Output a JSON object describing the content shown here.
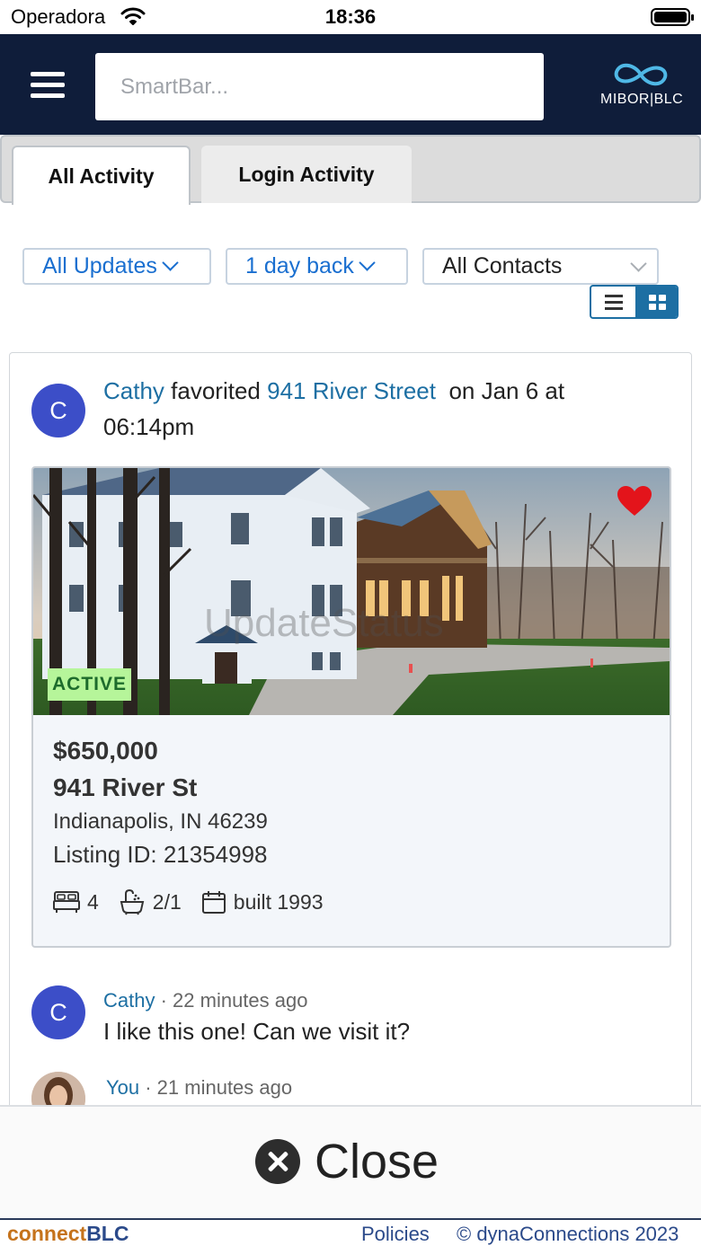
{
  "status_bar": {
    "carrier": "Operadora",
    "time": "18:36"
  },
  "header": {
    "search": {
      "placeholder": "SmartBar..."
    },
    "logo_text": "MIBOR|BLC"
  },
  "tabs": [
    {
      "label": "All Activity",
      "active": true
    },
    {
      "label": "Login Activity",
      "active": false
    }
  ],
  "filters": {
    "updates": "All Updates",
    "timeframe": "1 day back",
    "contacts": "All Contacts"
  },
  "view_mode": "grid",
  "activity": {
    "avatar_initial": "C",
    "user": "Cathy",
    "action": "favorited",
    "property_link": "941 River Street",
    "when": "on Jan 6 at 06:14pm"
  },
  "listing": {
    "status_badge": "ACTIVE",
    "favorited": true,
    "watermark": "UpdateStatus",
    "price": "$650,000",
    "street": "941 River St",
    "city_line": "Indianapolis, IN 46239",
    "listing_id_label": "Listing ID: 21354998",
    "beds": "4",
    "baths": "2/1",
    "built": "built 1993"
  },
  "comments": [
    {
      "avatar_initial": "C",
      "author": "Cathy",
      "meta": " · 22 minutes ago",
      "text": "I like this one! Can we visit it?"
    },
    {
      "author": "You",
      "meta": " · 21 minutes ago"
    }
  ],
  "close_button": {
    "label": "Close"
  },
  "footer": {
    "brand_part1": "connect",
    "brand_part2": "BLC",
    "policies": "Policies",
    "copyright": "© dynaConnections 2023"
  },
  "colors": {
    "header_bg": "#0f1d3a",
    "link": "#1d6fa3",
    "filter_text": "#1a6fd0",
    "avatar": "#3c4ec8",
    "active_badge": "#b6f59a",
    "heart": "#e3141b"
  }
}
